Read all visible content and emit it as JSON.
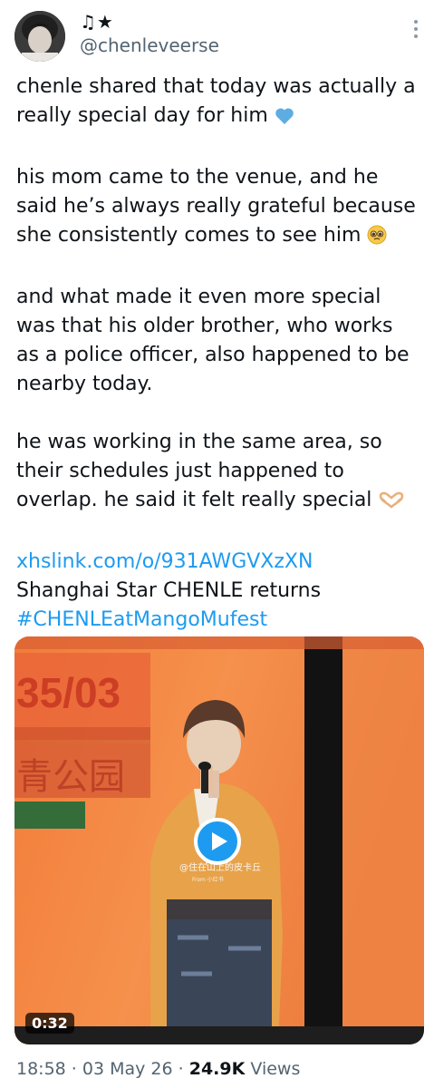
{
  "user": {
    "display_name": "♫★",
    "handle": "@chenleveerse"
  },
  "tweet": {
    "paragraphs": [
      {
        "text": "chenle shared that today was actually a really special day for him",
        "emoji": "blue-heart"
      },
      {
        "text": "his mom came to the venue, and he said he’s always really grateful because she consistently comes to see him",
        "emoji": "pleading-face"
      },
      {
        "text": "and what made it even more special was that his older brother, who works as a police officer, also happened to be nearby today.",
        "emoji": null
      },
      {
        "text": "he was working in the same area, so their schedules just happened to overlap. he said it felt really special",
        "emoji": "heart-hands"
      }
    ],
    "link": "xhslink.com/o/931AWGVXzXN",
    "caption": "Shanghai Star CHENLE returns",
    "hashtag": "#CHENLEatMangoMufest"
  },
  "media": {
    "duration": "0:32",
    "board_text_top": "35/03",
    "board_text_mid": "青公园",
    "watermark": "@住在山上的皮卡丘",
    "watermark_sub": "From 小红书"
  },
  "meta": {
    "time_date": "18:58 · 03 May 26 · ",
    "views_count": "24.9K",
    "views_label": " Views"
  },
  "colors": {
    "link": "#1d9bf0",
    "text": "#0f1419",
    "secondary": "#536471",
    "stage_orange": "#f28540"
  }
}
